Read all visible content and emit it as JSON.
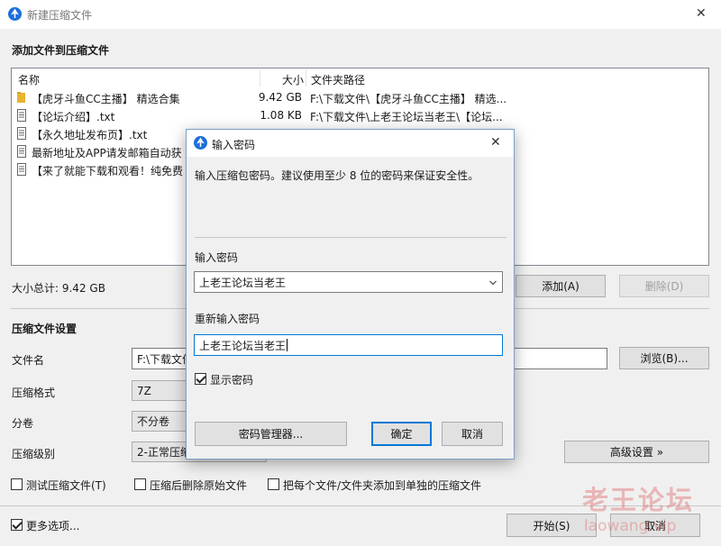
{
  "window": {
    "title": "新建压缩文件",
    "close_glyph": "✕"
  },
  "main": {
    "section_add": "添加文件到压缩文件",
    "table": {
      "headers": {
        "name": "名称",
        "size": "大小",
        "path": "文件夹路径"
      },
      "rows": [
        {
          "icon": "folder-icon",
          "name": "【虎牙斗鱼CC主播】 精选合集",
          "size": "9.42 GB",
          "path": "F:\\下载文件\\【虎牙斗鱼CC主播】 精选..."
        },
        {
          "icon": "file-icon",
          "name": "【论坛介绍】.txt",
          "size": "1.08 KB",
          "path": "F:\\下载文件\\上老王论坛当老王\\【论坛..."
        },
        {
          "icon": "file-icon",
          "name": "【永久地址发布页】.txt",
          "size": "",
          "path": ""
        },
        {
          "icon": "file-icon",
          "name": "最新地址及APP请发邮箱自动获",
          "size": "",
          "path": ""
        },
        {
          "icon": "file-icon",
          "name": "【来了就能下载和观看！纯免费",
          "size": "",
          "path": ""
        }
      ]
    },
    "total_size": "大小总计: 9.42 GB",
    "add_button": "添加(A)",
    "delete_button": "删除(D)",
    "section_settings": "压缩文件设置",
    "filename_label": "文件名",
    "filename_value": "F:\\下载文件",
    "browse_button": "浏览(B)...",
    "format_label": "压缩格式",
    "format_value": "7Z",
    "split_label": "分卷",
    "split_value": "不分卷",
    "level_label": "压缩级别",
    "level_value": "2-正常压缩",
    "advanced_button": "高级设置 »",
    "test_checkbox": "测试压缩文件(T)",
    "delete_after_checkbox": "压缩后删除原始文件",
    "separate_checkbox": "把每个文件/文件夹添加到单独的压缩文件",
    "more_options_checkbox": "更多选项...",
    "start_button": "开始(S)",
    "cancel_button": "取消"
  },
  "dialog": {
    "title": "输入密码",
    "close_glyph": "✕",
    "description": "输入压缩包密码。建议使用至少 8 位的密码来保证安全性。",
    "password_label": "输入密码",
    "password_value": "上老王论坛当老王",
    "reenter_label": "重新输入密码",
    "reenter_value": "上老王论坛当老王",
    "show_password": "显示密码",
    "show_password_checked": true,
    "manager_button": "密码管理器...",
    "ok_button": "确定",
    "cancel_button": "取消"
  },
  "watermark": {
    "line1": "老王论坛",
    "line2": "laowang.vip"
  },
  "colors": {
    "accent": "#0078d7",
    "brand_blue": "#1e6fd9",
    "folder": "#e8b434",
    "watermark": "#e07070"
  }
}
